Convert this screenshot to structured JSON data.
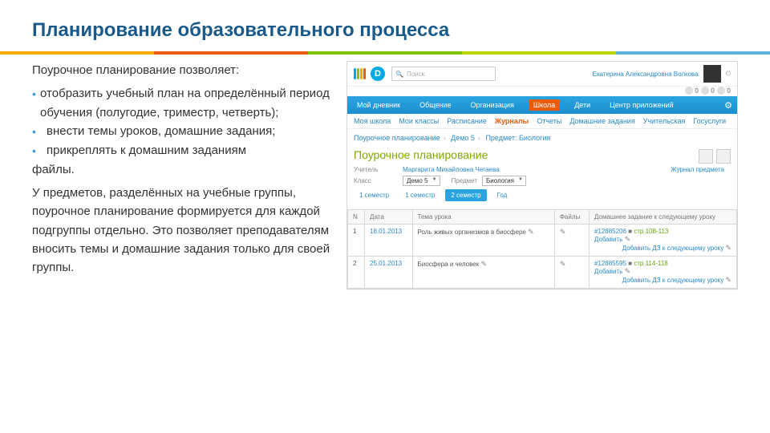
{
  "title": "Планирование образовательного процесса",
  "intro": "Поурочное планирование позволяет:",
  "bullets": [
    "отобразить учебный план на определённый период обучения (полугодие, триместр, четверть);",
    "внести темы уроков, домашние задания;",
    "прикреплять к домашним заданиям"
  ],
  "bullets_tail": "файлы.",
  "para2": "У предметов, разделённых на учебные группы, поурочное планирование формируется для каждой подгруппы отдельно. Это позволяет преподавателям вносить темы и домашние задания только для своей группы.",
  "app": {
    "search_placeholder": "Поиск",
    "user_name": "Екатерина Александровна Волкова",
    "counts": [
      "0",
      "0",
      "0"
    ],
    "nav": [
      "Мой дневник",
      "Общение",
      "Организация",
      "Школа",
      "Дети",
      "Центр приложений"
    ],
    "nav_active": 3,
    "subnav": [
      "Моя школа",
      "Мои классы",
      "Расписание",
      "Журналы",
      "Отчеты",
      "Домашние задания",
      "Учительская",
      "Госуслуги"
    ],
    "subnav_active": 3,
    "breadcrumb": [
      "Поурочное планирование",
      "Демо 5",
      "Предмет",
      "Биология"
    ],
    "page_heading": "Поурочное планирование",
    "teacher_lbl": "Учитель",
    "teacher_val": "Маргарита Михайловна Чегаева",
    "class_lbl": "Класс",
    "class_val": "Демо 5",
    "subject_lbl": "Предмет",
    "subject_val": "Биология",
    "period_tabs": [
      "1 семестр",
      "1 семестр",
      "2 семестр",
      "Год"
    ],
    "period_active": 2,
    "right_link": "Журнал предмета",
    "table": {
      "headers": [
        "N",
        "Дата",
        "Тема урока",
        "Файлы",
        "Домашнее задание к следующему уроку"
      ],
      "rows": [
        {
          "n": "1",
          "date": "18.01.2013",
          "topic": "Роль живых организмов в биосфере",
          "hw_id": "#12885206",
          "hw_pages": "стр 108-113",
          "add": "Добавить",
          "addnext": "Добавить ДЗ к следующему уроку"
        },
        {
          "n": "2",
          "date": "25.01.2013",
          "topic": "Биосфера и человек",
          "hw_id": "#12885595",
          "hw_pages": "стр 114-118",
          "add": "Добавить",
          "addnext": "Добавить ДЗ к следующему уроку"
        }
      ]
    }
  }
}
